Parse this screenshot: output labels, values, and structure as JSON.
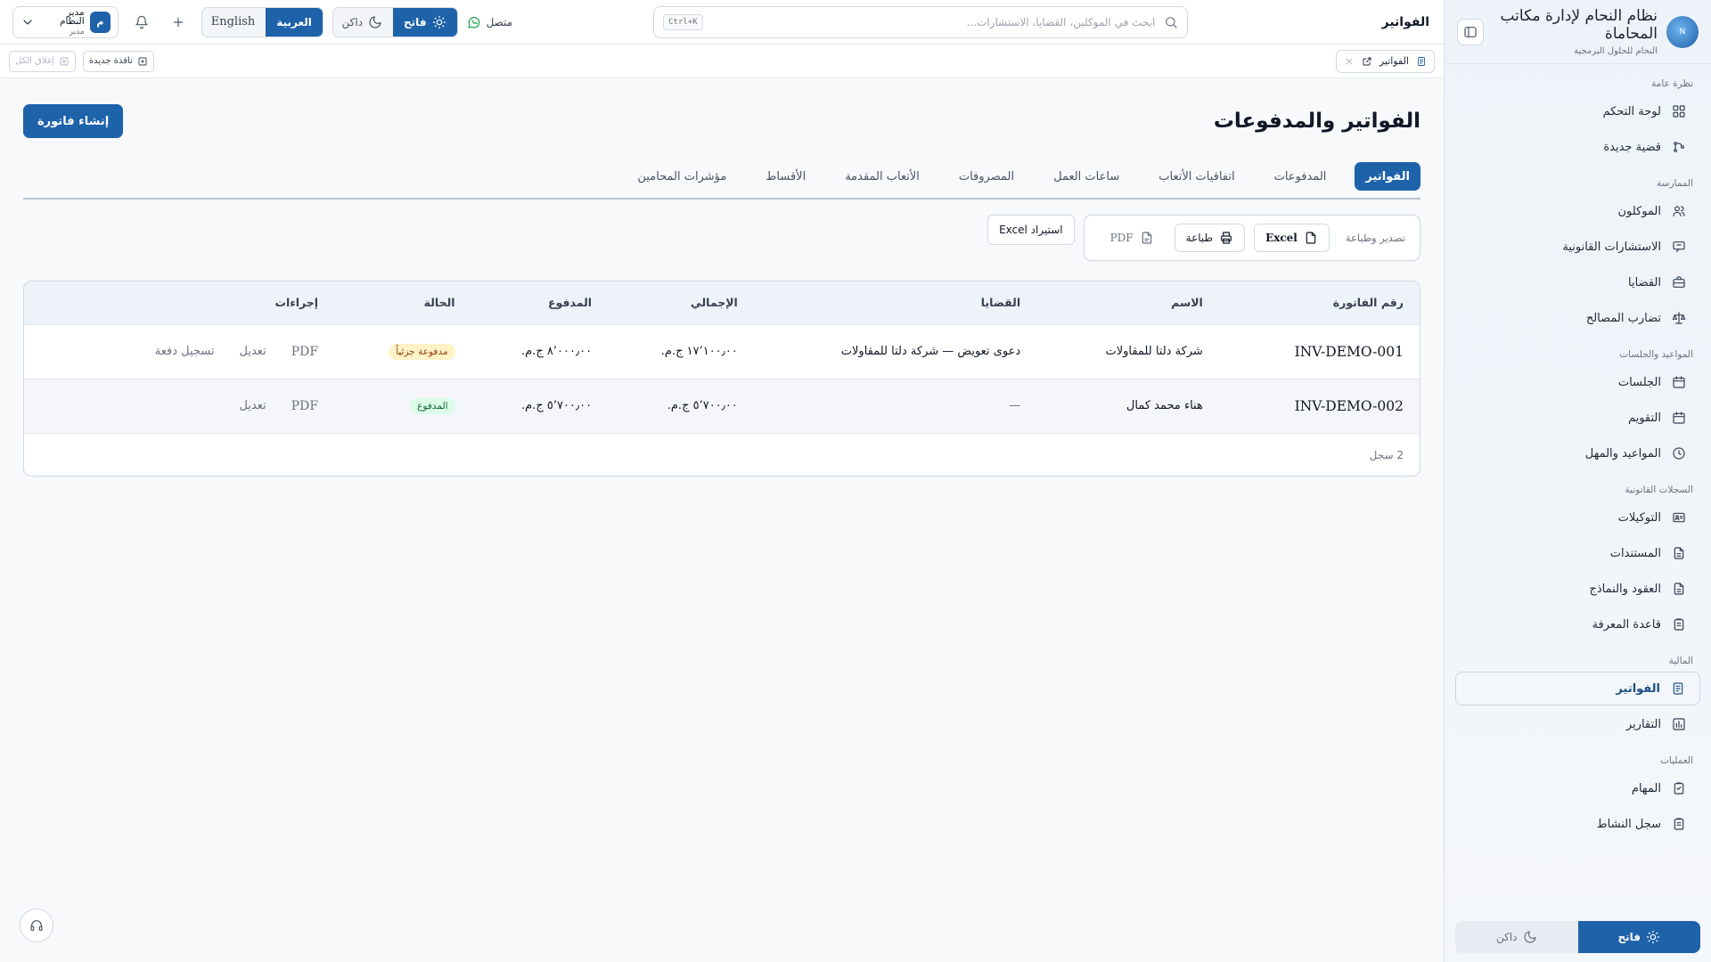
{
  "sidebar": {
    "brand_title": "نظام النحام لإدارة مكاتب المحاماة",
    "brand_sub": "النحام للحلول البرمجية",
    "logo_text": "N",
    "sections": [
      {
        "title": "نظرة عامة",
        "items": [
          {
            "label": "لوحة التحكم",
            "icon": "dashboard-icon"
          },
          {
            "label": "قضية جديدة",
            "icon": "new-case-icon"
          }
        ]
      },
      {
        "title": "الممارسة",
        "items": [
          {
            "label": "الموكلون",
            "icon": "users-icon"
          },
          {
            "label": "الاستشارات القانونية",
            "icon": "consultation-icon"
          },
          {
            "label": "القضايا",
            "icon": "briefcase-icon"
          },
          {
            "label": "تضارب المصالح",
            "icon": "scale-icon"
          }
        ]
      },
      {
        "title": "المواعيد والجلسات",
        "items": [
          {
            "label": "الجلسات",
            "icon": "calendar-icon"
          },
          {
            "label": "التقويم",
            "icon": "calendar-icon"
          },
          {
            "label": "المواعيد والمهل",
            "icon": "clock-icon"
          }
        ]
      },
      {
        "title": "السجلات القانونية",
        "items": [
          {
            "label": "التوكيلات",
            "icon": "id-card-icon"
          },
          {
            "label": "المستندات",
            "icon": "file-icon"
          },
          {
            "label": "العقود والنماذج",
            "icon": "file-icon"
          },
          {
            "label": "قاعدة المعرفة",
            "icon": "clipboard-icon"
          }
        ]
      },
      {
        "title": "المالية",
        "items": [
          {
            "label": "الفواتير",
            "icon": "invoice-icon",
            "active": true
          },
          {
            "label": "التقارير",
            "icon": "bar-chart-icon"
          }
        ]
      },
      {
        "title": "العمليات",
        "items": [
          {
            "label": "المهام",
            "icon": "tasks-icon"
          },
          {
            "label": "سجل النشاط",
            "icon": "clipboard-icon"
          }
        ]
      }
    ],
    "theme_light": "فاتح",
    "theme_dark": "داكن"
  },
  "topbar": {
    "page_name": "الفواتير",
    "search_placeholder": "ابحث في الموكلين، القضايا، الاستشارات...",
    "shortcut": "Ctrl+K",
    "status": "متصل",
    "theme_light": "فاتح",
    "theme_dark": "داكن",
    "lang_ar": "العربية",
    "lang_en": "English",
    "user_initial": "م",
    "user_name": "مدير النظام",
    "user_role": "مدير"
  },
  "tabstrip": {
    "open_tab": "الفواتير",
    "new_window": "نافذة جديدة",
    "close_all": "إغلاق الكل"
  },
  "page": {
    "title": "الفواتير والمدفوعات",
    "create_button": "إنشاء فاتورة",
    "tabs": [
      "الفواتير",
      "المدفوعات",
      "اتفاقيات الأتعاب",
      "ساعات العمل",
      "المصروفات",
      "الأتعاب المقدمة",
      "الأقساط",
      "مؤشرات المحامين"
    ],
    "export_label": "تصدير وطباعة",
    "excel_label": "Excel",
    "print_label": "طباعة",
    "pdf_label": "PDF",
    "import_label": "استيراد Excel"
  },
  "table": {
    "columns": [
      "رقم الفاتورة",
      "الاسم",
      "القضايا",
      "الإجمالي",
      "المدفوع",
      "الحالة",
      "إجراءات"
    ],
    "rows": [
      {
        "number": "INV-DEMO-001",
        "name": "شركة دلتا للمقاولات",
        "case": "دعوى تعويض — شركة دلتا للمقاولات",
        "total": "١٧٬١٠٠٫٠٠ ج.م.",
        "paid": "٨٬٠٠٠٫٠٠ ج.م.",
        "status": "مدفوعة جزئياً",
        "status_kind": "partial",
        "actions": [
          "PDF",
          "تعديل",
          "تسجيل دفعة"
        ]
      },
      {
        "number": "INV-DEMO-002",
        "name": "هناء محمد كمال",
        "case": "—",
        "total": "٥٬٧٠٠٫٠٠ ج.م.",
        "paid": "٥٬٧٠٠٫٠٠ ج.م.",
        "status": "المدفوع",
        "status_kind": "paid",
        "actions": [
          "PDF",
          "تعديل"
        ]
      }
    ],
    "footer": "2 سجل"
  },
  "colors": {
    "accent": "#1e62aa",
    "partial_badge": "#fef3c7",
    "paid_badge": "#dcfce7",
    "online": "#16a34a"
  }
}
